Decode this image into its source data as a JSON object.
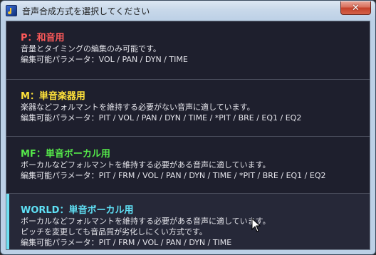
{
  "window": {
    "title": "音声合成方式を選択してください",
    "close_label": "✕"
  },
  "options": [
    {
      "title": "P：和音用",
      "title_color": "#ff5a5a",
      "lines": [
        "音量とタイミングの編集のみ可能です。",
        "編集可能パラメータ：VOL / PAN / DYN / TIME"
      ]
    },
    {
      "title": "M：単音楽器用",
      "title_color": "#ffe23a",
      "lines": [
        "楽器などフォルマントを維持する必要がない音声に適しています。",
        "編集可能パラメータ：PIT / VOL / PAN / DYN / TIME / *PIT / BRE / EQ1 / EQ2"
      ]
    },
    {
      "title": "MF：単音ボーカル用",
      "title_color": "#55e84a",
      "lines": [
        "ボーカルなどフォルマントを維持する必要がある音声に適しています。",
        "編集可能パラメータ：PIT / FRM / VOL / PAN / DYN / TIME / *PIT / BRE / EQ1 / EQ2"
      ]
    },
    {
      "title": "WORLD：単音ボーカル用",
      "title_color": "#5fe0f5",
      "lines": [
        "ボーカルなどフォルマントを維持する必要がある音声に適しています。",
        "ピッチを変更しても音品質が劣化しにくい方式です。",
        "編集可能パラメータ：PIT / FRM / VOL / PAN / DYN / TIME"
      ]
    }
  ]
}
